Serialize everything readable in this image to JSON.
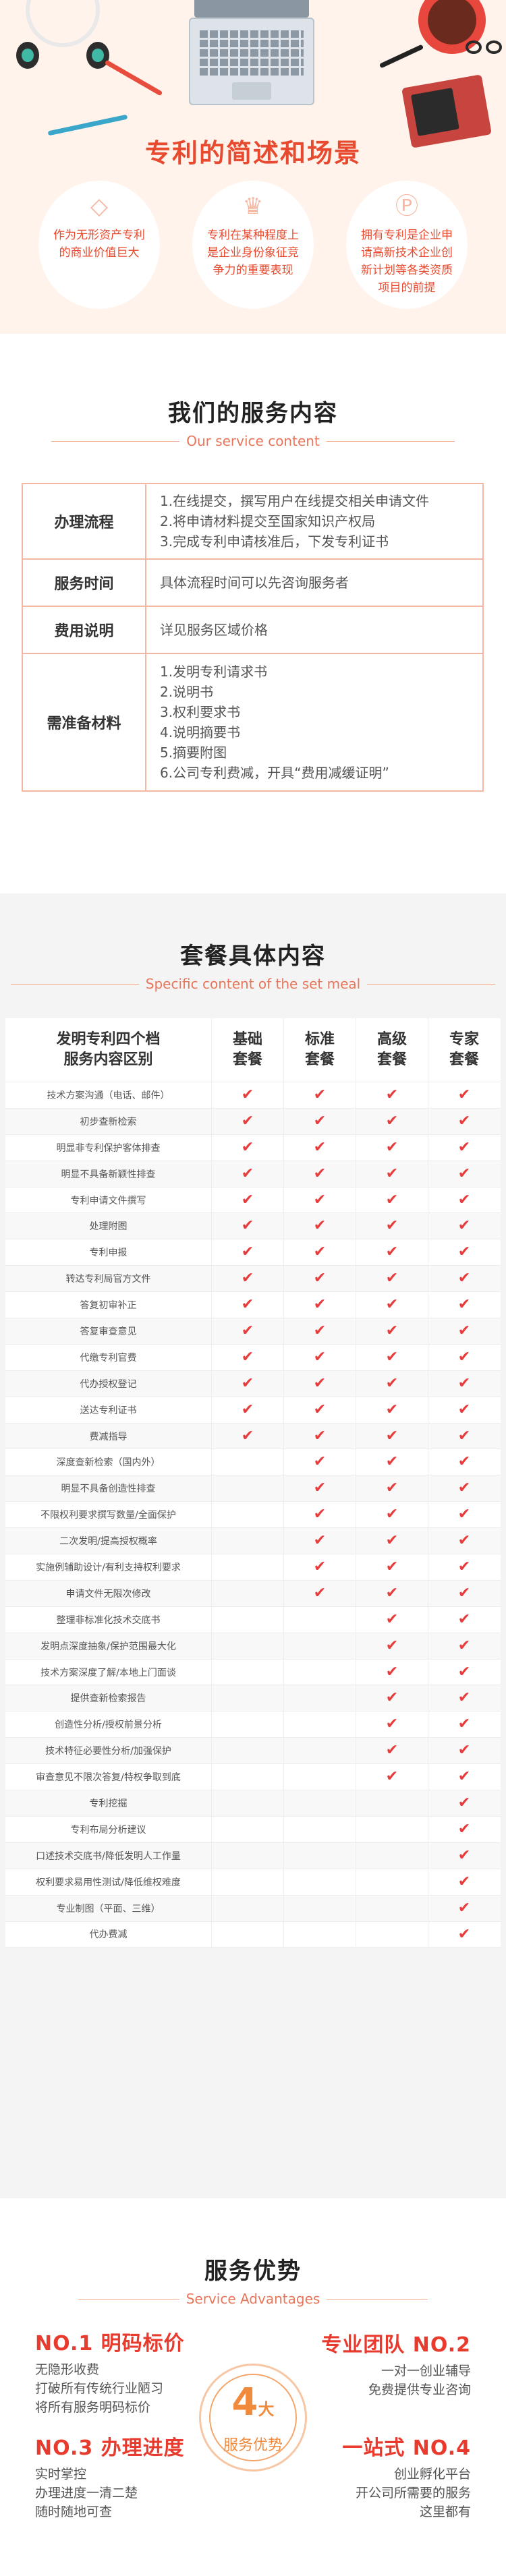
{
  "hero": {
    "title": "专利的简述和场景",
    "badges": [
      {
        "icon": "diamond-icon",
        "glyph": "◇",
        "text": "作为无形资产专利的商业价值巨大"
      },
      {
        "icon": "crown-icon",
        "glyph": "♛",
        "text": "专利在某种程度上是企业身份象征竞争力的重要表现"
      },
      {
        "icon": "patent-p-icon",
        "glyph": "Ⓟ",
        "text": "拥有专利是企业申请高新技术企业创新计划等各类资质项目的前提"
      }
    ]
  },
  "service": {
    "title_cn": "我们的服务内容",
    "title_en": "Our service content",
    "rows": [
      {
        "label": "办理流程",
        "lines": [
          "1.在线提交，撰写用户在线提交相关申请文件",
          "2.将申请材料提交至国家知识产权局",
          "3.完成专利申请核准后，下发专利证书"
        ]
      },
      {
        "label": "服务时间",
        "lines": [
          "具体流程时间可以先咨询服务者"
        ]
      },
      {
        "label": "费用说明",
        "lines": [
          "详见服务区域价格"
        ]
      },
      {
        "label": "需准备材料",
        "lines": [
          "1.发明专利请求书",
          "2.说明书",
          "3.权利要求书",
          "4.说明摘要书",
          "5.摘要附图",
          "6.公司专利费减，开具“费用减缓证明”"
        ]
      }
    ]
  },
  "package": {
    "title_cn": "套餐具体内容",
    "title_en": "Specific content of the set meal",
    "header": {
      "name": "发明专利四个档\n服务内容区别",
      "tiers": [
        "基础\n套餐",
        "标准\n套餐",
        "高级\n套餐",
        "专家\n套餐"
      ]
    },
    "check": "✔",
    "rows": [
      {
        "name": "技术方案沟通（电话、邮件）",
        "has": [
          true,
          true,
          true,
          true
        ]
      },
      {
        "name": "初步查新检索",
        "has": [
          true,
          true,
          true,
          true
        ]
      },
      {
        "name": "明显非专利保护客体排查",
        "has": [
          true,
          true,
          true,
          true
        ]
      },
      {
        "name": "明显不具备新颖性排查",
        "has": [
          true,
          true,
          true,
          true
        ]
      },
      {
        "name": "专利申请文件撰写",
        "has": [
          true,
          true,
          true,
          true
        ]
      },
      {
        "name": "处理附图",
        "has": [
          true,
          true,
          true,
          true
        ]
      },
      {
        "name": "专利申报",
        "has": [
          true,
          true,
          true,
          true
        ]
      },
      {
        "name": "转达专利局官方文件",
        "has": [
          true,
          true,
          true,
          true
        ]
      },
      {
        "name": "答复初审补正",
        "has": [
          true,
          true,
          true,
          true
        ]
      },
      {
        "name": "答复审查意见",
        "has": [
          true,
          true,
          true,
          true
        ]
      },
      {
        "name": "代缴专利官费",
        "has": [
          true,
          true,
          true,
          true
        ]
      },
      {
        "name": "代办授权登记",
        "has": [
          true,
          true,
          true,
          true
        ]
      },
      {
        "name": "送达专利证书",
        "has": [
          true,
          true,
          true,
          true
        ]
      },
      {
        "name": "费减指导",
        "has": [
          true,
          true,
          true,
          true
        ]
      },
      {
        "name": "深度查新检索（国内外）",
        "has": [
          false,
          true,
          true,
          true
        ]
      },
      {
        "name": "明显不具备创造性排查",
        "has": [
          false,
          true,
          true,
          true
        ]
      },
      {
        "name": "不限权利要求撰写数量/全面保护",
        "has": [
          false,
          true,
          true,
          true
        ]
      },
      {
        "name": "二次发明/提高授权概率",
        "has": [
          false,
          true,
          true,
          true
        ]
      },
      {
        "name": "实施例辅助设计/有利支持权利要求",
        "has": [
          false,
          true,
          true,
          true
        ]
      },
      {
        "name": "申请文件无限次修改",
        "has": [
          false,
          true,
          true,
          true
        ]
      },
      {
        "name": "整理非标准化技术交底书",
        "has": [
          false,
          false,
          true,
          true
        ]
      },
      {
        "name": "发明点深度抽象/保护范围最大化",
        "has": [
          false,
          false,
          true,
          true
        ]
      },
      {
        "name": "技术方案深度了解/本地上门面谈",
        "has": [
          false,
          false,
          true,
          true
        ]
      },
      {
        "name": "提供查新检索报告",
        "has": [
          false,
          false,
          true,
          true
        ]
      },
      {
        "name": "创造性分析/授权前景分析",
        "has": [
          false,
          false,
          true,
          true
        ]
      },
      {
        "name": "技术特征必要性分析/加强保护",
        "has": [
          false,
          false,
          true,
          true
        ]
      },
      {
        "name": "审查意见不限次答复/特权争取到底",
        "has": [
          false,
          false,
          true,
          true
        ]
      },
      {
        "name": "专利挖掘",
        "has": [
          false,
          false,
          false,
          true
        ]
      },
      {
        "name": "专利布局分析建议",
        "has": [
          false,
          false,
          false,
          true
        ]
      },
      {
        "name": "口述技术交底书/降低发明人工作量",
        "has": [
          false,
          false,
          false,
          true
        ]
      },
      {
        "name": "权利要求易用性测试/降低维权难度",
        "has": [
          false,
          false,
          false,
          true
        ]
      },
      {
        "name": "专业制图（平面、三维）",
        "has": [
          false,
          false,
          false,
          true
        ]
      },
      {
        "name": "代办费减",
        "has": [
          false,
          false,
          false,
          true
        ]
      }
    ]
  },
  "advantages": {
    "title_cn": "服务优势",
    "title_en": "Service Advantages",
    "center_number": "4",
    "center_unit": "大",
    "center_label": "服务优势",
    "items": [
      {
        "title": "NO.1 明码标价",
        "lines": [
          "无隐形收费",
          "打破所有传统行业陋习",
          "将所有服务明码标价"
        ]
      },
      {
        "title": "专业团队 NO.2",
        "lines": [
          "一对一创业辅导",
          "免费提供专业咨询"
        ]
      },
      {
        "title": "NO.3 办理进度",
        "lines": [
          "实时掌控",
          "办理进度一清二楚",
          "随时随地可查"
        ]
      },
      {
        "title": "一站式 NO.4",
        "lines": [
          "创业孵化平台",
          "开公司所需要的服务",
          "这里都有"
        ]
      }
    ]
  },
  "colors": {
    "accent": "#e74a2e",
    "check": "#e83b3b",
    "border": "#f3b7a2"
  }
}
